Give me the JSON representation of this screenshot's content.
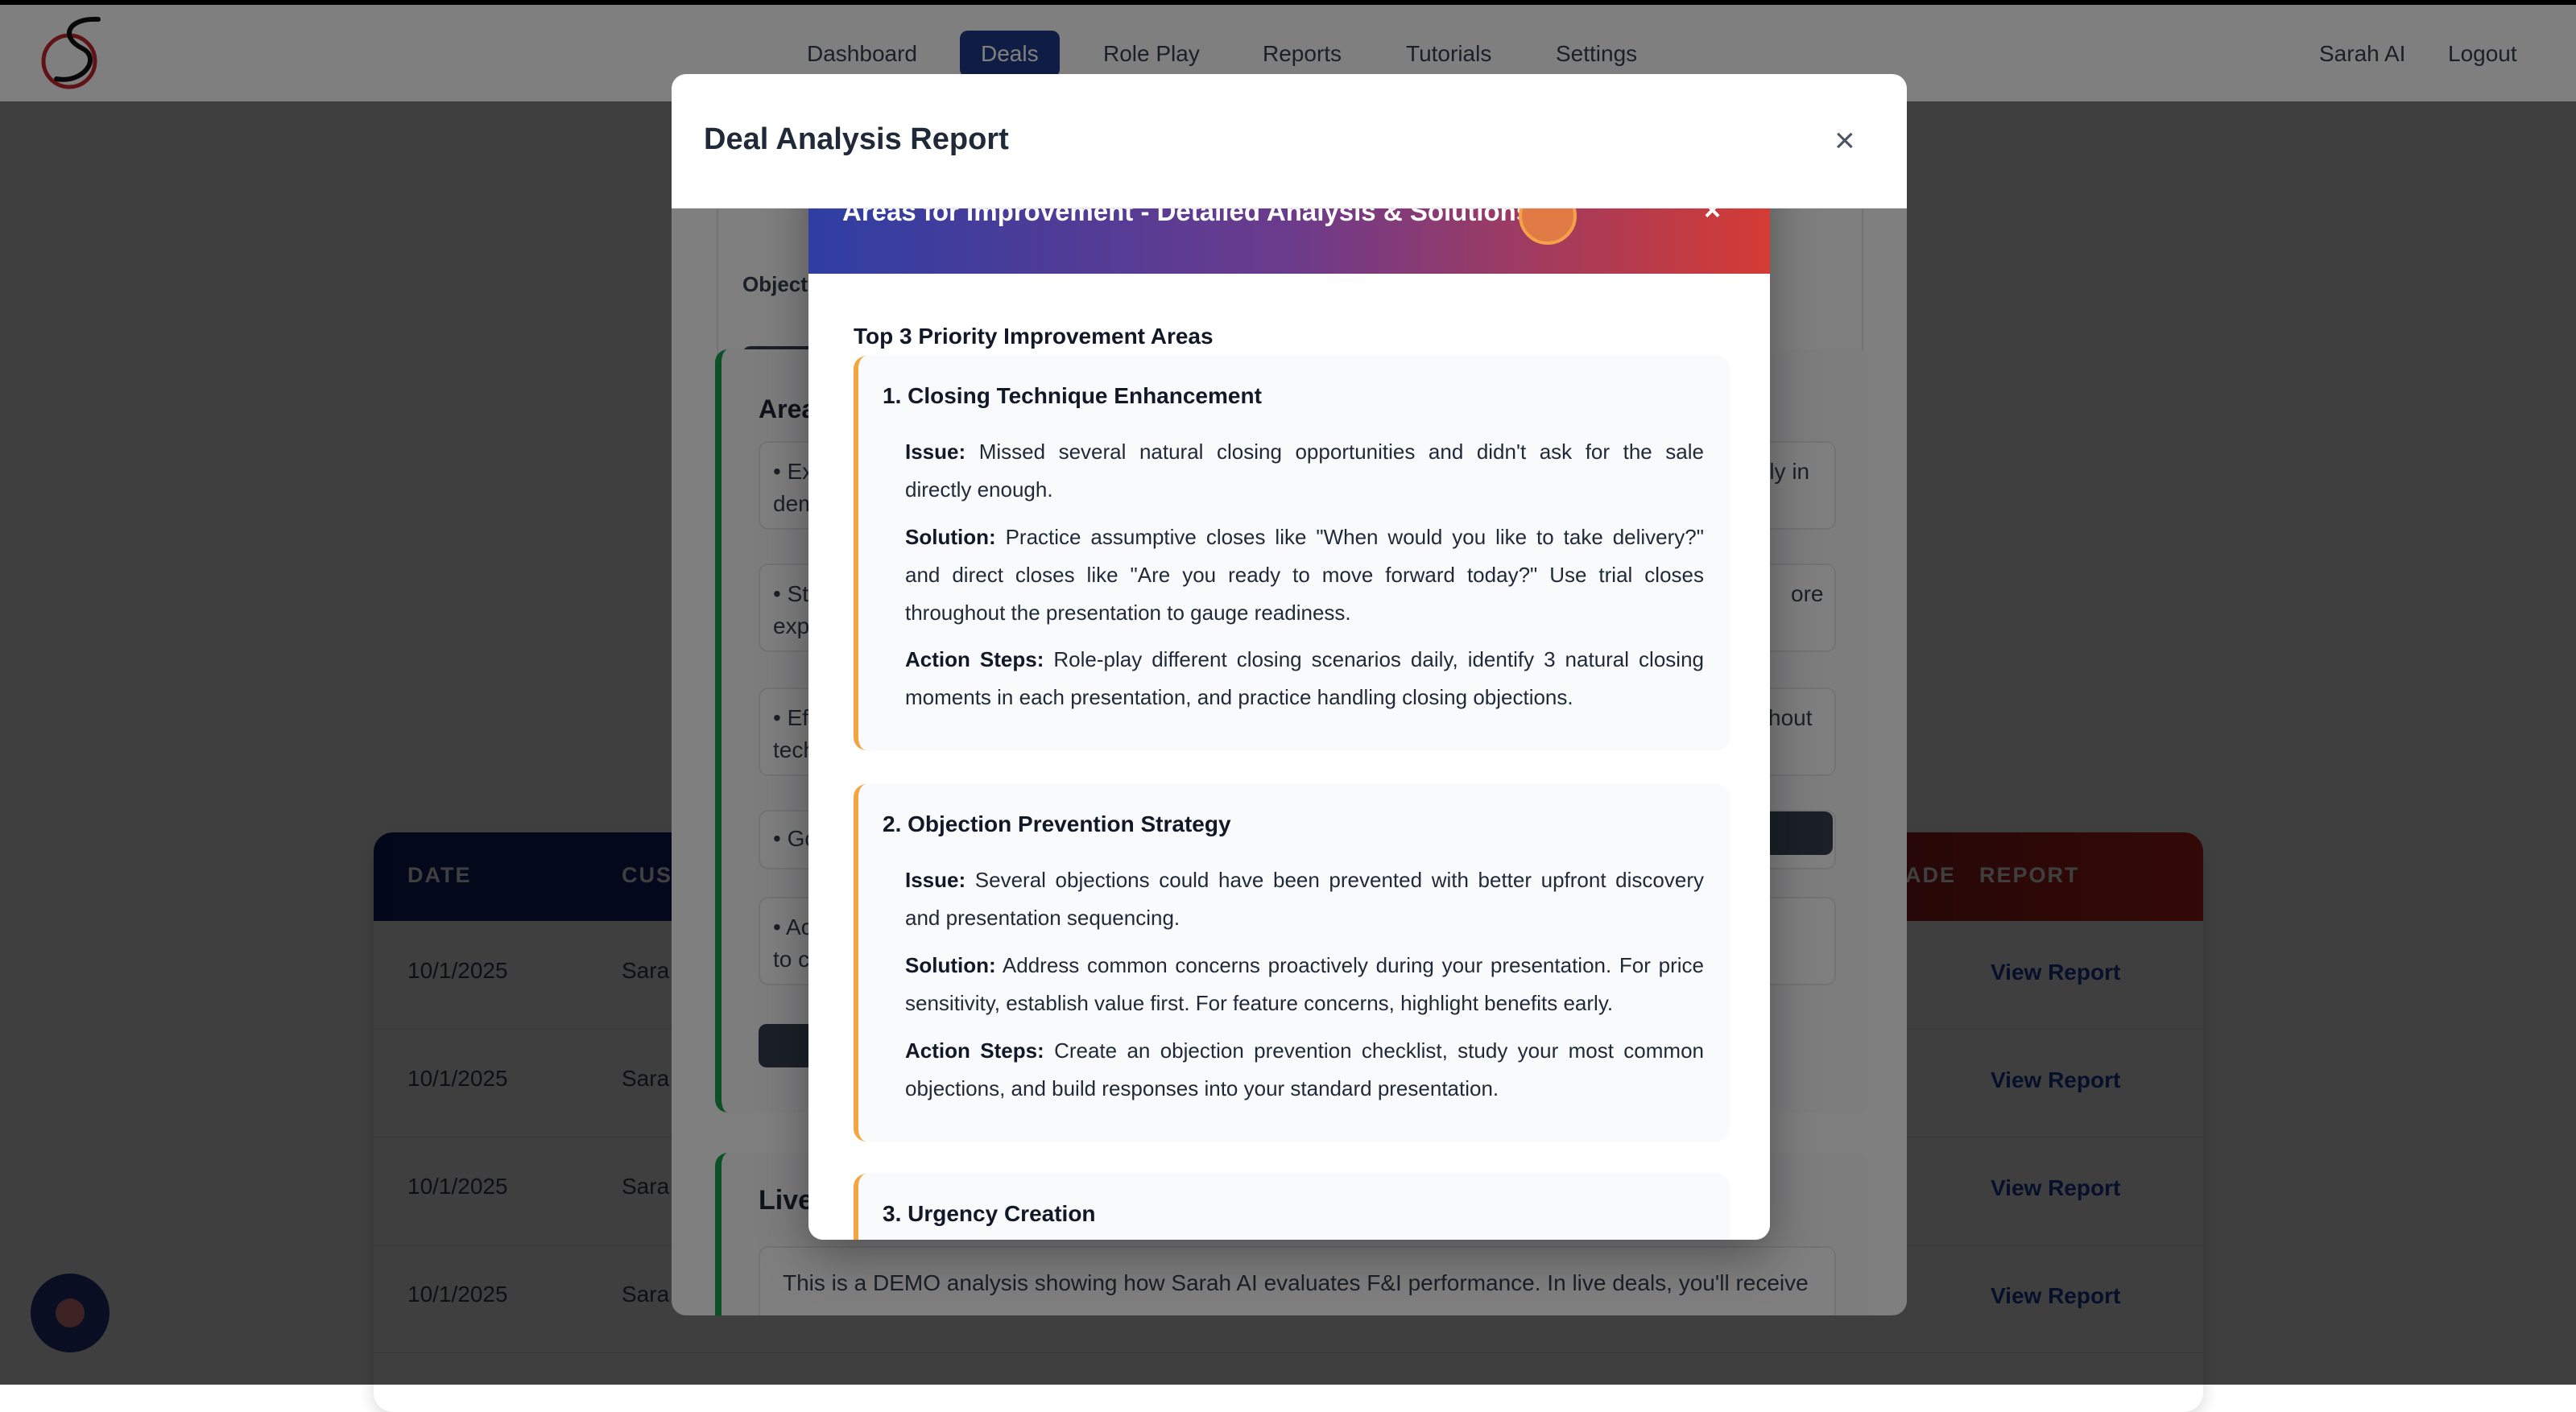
{
  "nav": {
    "items": [
      {
        "label": "Dashboard"
      },
      {
        "label": "Deals"
      },
      {
        "label": "Role Play"
      },
      {
        "label": "Reports"
      },
      {
        "label": "Tutorials"
      },
      {
        "label": "Settings"
      }
    ],
    "active": "Deals",
    "user": "Sarah AI",
    "logout": "Logout"
  },
  "table": {
    "headers": [
      "DATE",
      "CUST",
      "ADE",
      "REPORT"
    ],
    "rows": [
      {
        "date": "10/1/2025",
        "customer": "Sara",
        "report": "View Report"
      },
      {
        "date": "10/1/2025",
        "customer": "Sara",
        "report": "View Report"
      },
      {
        "date": "10/1/2025",
        "customer": "Sara",
        "report": "View Report"
      },
      {
        "date": "10/1/2025",
        "customer": "Sara",
        "report": "View Report"
      }
    ]
  },
  "report_modal": {
    "title": "Deal Analysis Report",
    "close": "×",
    "objections_label": "Objecti",
    "areas_heading": "Area",
    "area_items": [
      {
        "left1": "• Ex",
        "left2": "dem",
        "right": "rly in"
      },
      {
        "left1": "• Str",
        "left2": "expl",
        "right": "ore"
      },
      {
        "left1": "• Eff",
        "left2": "tech",
        "right": "hout"
      },
      {
        "left1": "• Go",
        "left2": "",
        "right": ""
      },
      {
        "left1": "• Ac",
        "left2": "to cu",
        "right": ""
      }
    ],
    "live_heading": "Live",
    "live_text": "This is a DEMO analysis showing how Sarah AI evaluates F&I performance. In live deals, you'll receive"
  },
  "improvement_modal": {
    "title": "Areas for Improvement - Detailed Analysis & Solutions",
    "close": "×",
    "priority_title": "Top 3 Priority Improvement Areas",
    "areas": [
      {
        "title": "1. Closing Technique Enhancement",
        "issue_label": "Issue:",
        "issue_line1": "Missed several natural closing opportunities and didn't ask for the sale",
        "issue_line2": "directly enough.",
        "solution_label": "Solution:",
        "solution_line1": "Practice assumptive closes like \"When would you like to take delivery?\"",
        "solution_line2": "and direct closes like \"Are you ready to move forward today?\" Use trial closes",
        "solution_line3": "throughout the presentation to gauge readiness.",
        "action_label": "Action Steps:",
        "action_line1": "Role-play different closing scenarios daily, identify 3 natural closing",
        "action_line2": "moments in each presentation, and practice handling closing objections."
      },
      {
        "title": "2. Objection Prevention Strategy",
        "issue_label": "Issue:",
        "issue_line1": "Several objections could have been prevented with better upfront discovery",
        "issue_line2": "and presentation sequencing.",
        "solution_label": "Solution:",
        "solution_line1": "Address common concerns proactively during your presentation. For price",
        "solution_line2": "sensitivity, establish value first. For feature concerns, highlight benefits early.",
        "action_label": "Action Steps:",
        "action_line1": "Create an objection prevention checklist, study your most common",
        "action_line2": "objections, and build responses into your standard presentation."
      },
      {
        "title": "3. Urgency Creation"
      }
    ]
  },
  "colors": {
    "nav_active": "#1e3a8a",
    "accent_orange": "#f2a541",
    "card_border_green": "#16a34a",
    "link_blue": "#1e40af"
  }
}
